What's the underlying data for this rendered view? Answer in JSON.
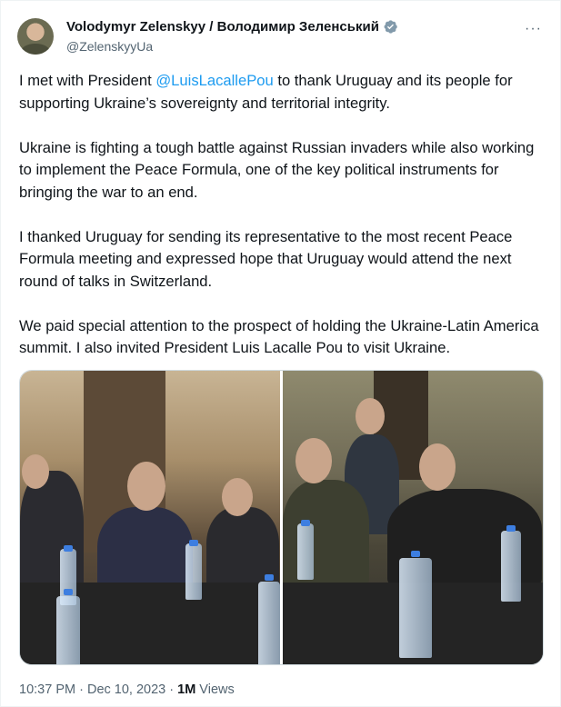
{
  "author": {
    "display_name": "Volodymyr Zelenskyy / Володимир Зеленський",
    "handle": "@ZelenskyyUa",
    "verified_color": "#829aab",
    "avatar_icon": "avatar-image"
  },
  "menu": {
    "more_label": "···"
  },
  "post": {
    "p1_before": "I met with President ",
    "p1_mention": "@LuisLacallePou",
    "p1_after": " to thank Uruguay and its people for supporting Ukraine’s sovereignty and territorial integrity.",
    "p2": "Ukraine is fighting a tough battle against Russian invaders while also working to implement the Peace Formula, one of the key political instruments for bringing the war to an end.",
    "p3": "I thanked Uruguay for sending its representative to the most recent Peace Formula meeting and expressed hope that Uruguay would attend the next round of talks in Switzerland.",
    "p4": "We paid special attention to the prospect of holding the Ukraine-Latin America summit. I also invited President Luis Lacalle Pou to visit Ukraine."
  },
  "meta": {
    "time": "10:37 PM",
    "sep": " · ",
    "date": "Dec 10, 2023",
    "views_count": "1M",
    "views_label": " Views"
  },
  "colors": {
    "mention": "#1d9bf0",
    "secondary_text": "#536471"
  }
}
